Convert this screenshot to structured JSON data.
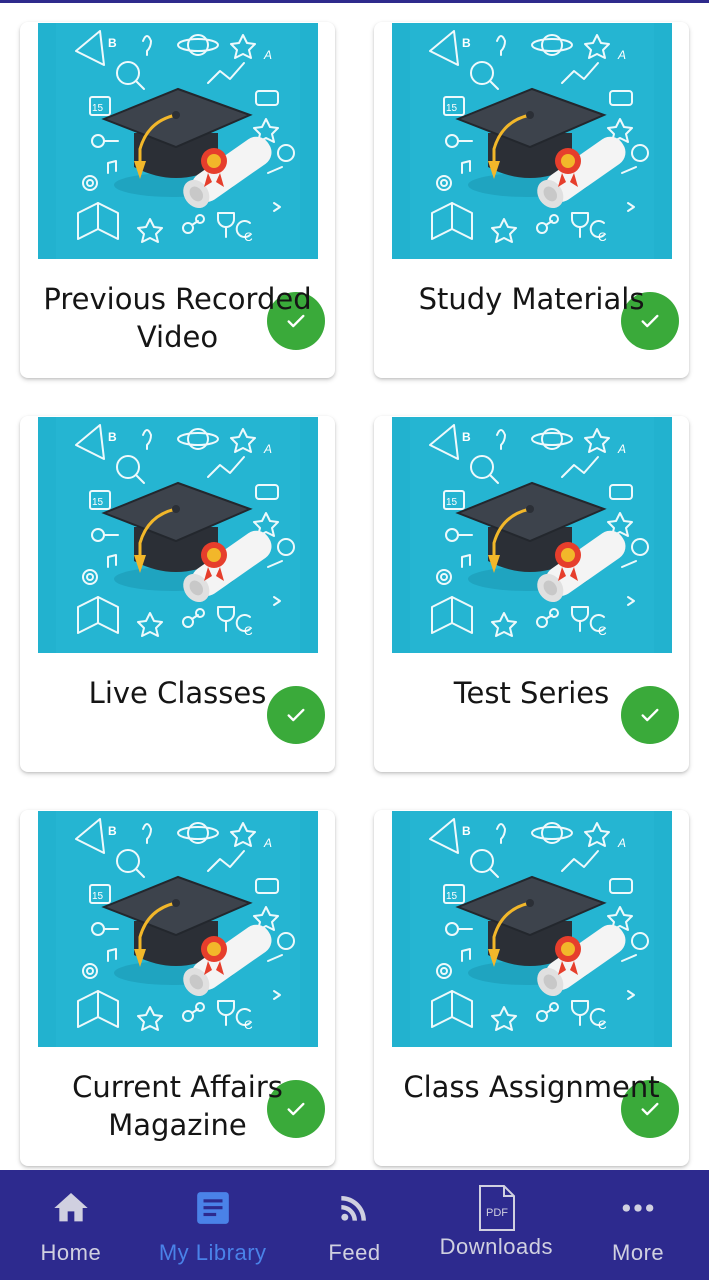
{
  "cards": [
    {
      "title": "Previous Recorded Video",
      "status_icon": "check-icon"
    },
    {
      "title": "Study Materials",
      "status_icon": "check-icon"
    },
    {
      "title": "Live Classes",
      "status_icon": "check-icon"
    },
    {
      "title": "Test Series",
      "status_icon": "check-icon"
    },
    {
      "title": "Current Affairs Magazine",
      "status_icon": "check-icon"
    },
    {
      "title": "Class Assignment",
      "status_icon": "check-icon"
    }
  ],
  "bottom_nav": {
    "items": [
      {
        "label": "Home",
        "icon": "home-icon",
        "active": false
      },
      {
        "label": "My Library",
        "icon": "library-icon",
        "active": true
      },
      {
        "label": "Feed",
        "icon": "rss-feed-icon",
        "active": false
      },
      {
        "label": "Downloads",
        "icon": "pdf-document-icon",
        "active": false
      },
      {
        "label": "More",
        "icon": "more-dots-icon",
        "active": false
      }
    ]
  },
  "colors": {
    "nav_background": "#2d2a8e",
    "nav_active": "#4a82e8",
    "thumbnail_background": "#22b2cf",
    "check_badge": "#3aaa3a"
  },
  "thumbnail_text": {
    "doodle_letter_b": "B",
    "doodle_letter_a": "A",
    "calendar_day": "15",
    "doodle_letter_c": "C",
    "pdf_label": "PDF"
  }
}
